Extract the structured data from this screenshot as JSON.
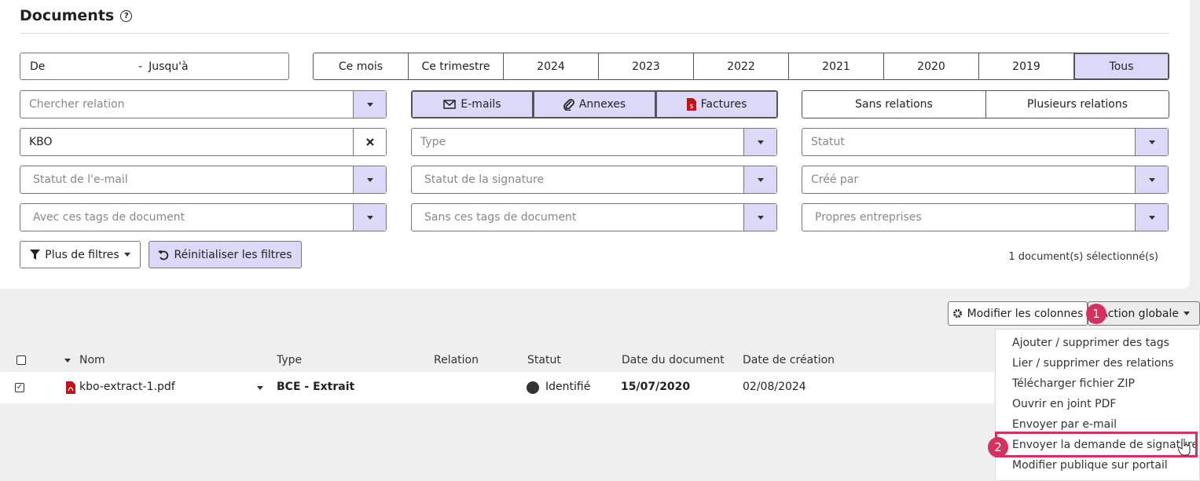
{
  "title": "Documents",
  "date_range": {
    "from": "De",
    "sep": "-",
    "to": "Jusqu'à"
  },
  "periods": [
    "Ce mois",
    "Ce trimestre",
    "2024",
    "2023",
    "2022",
    "2021",
    "2020",
    "2019",
    "Tous"
  ],
  "search_relation": "Chercher relation",
  "doc_kinds": [
    "E-mails",
    "Annexes",
    "Factures"
  ],
  "relation_modes": [
    "Sans relations",
    "Plusieurs relations"
  ],
  "kbo_value": "KBO",
  "type_ph": "Type",
  "statut_ph": "Statut",
  "email_status_ph": "Statut de l'e-mail",
  "signature_status_ph": "Statut de la signature",
  "created_by_ph": "Créé par",
  "with_tags_ph": "Avec ces tags de document",
  "without_tags_ph": "Sans ces tags de document",
  "own_companies_ph": "Propres entreprises",
  "more_filters": "Plus de filtres",
  "reset_filters": "Réinitialiser les filtres",
  "selected_count": "1 document(s) sélectionné(s)",
  "modify_columns": "Modifier les colonnes",
  "global_action": "Action globale",
  "badges": [
    "1",
    "2"
  ],
  "columns": [
    "Nom",
    "Type",
    "Relation",
    "Statut",
    "Date du document",
    "Date de création"
  ],
  "row": {
    "name": "kbo-extract-1.pdf",
    "type": "BCE - Extrait",
    "relation": "",
    "status": "Identifié",
    "doc_date": "15/07/2020",
    "created": "02/08/2024"
  },
  "menu": [
    "Ajouter / supprimer des tags",
    "Lier / supprimer des relations",
    "Télécharger fichier ZIP",
    "Ouvrir en joint PDF",
    "Envoyer par e-mail",
    "Envoyer la demande de signature",
    "Modifier publique sur portail"
  ],
  "colors": {
    "accent": "#dcd8f8",
    "badge": "#d6315e",
    "pdf": "#c0141c"
  }
}
